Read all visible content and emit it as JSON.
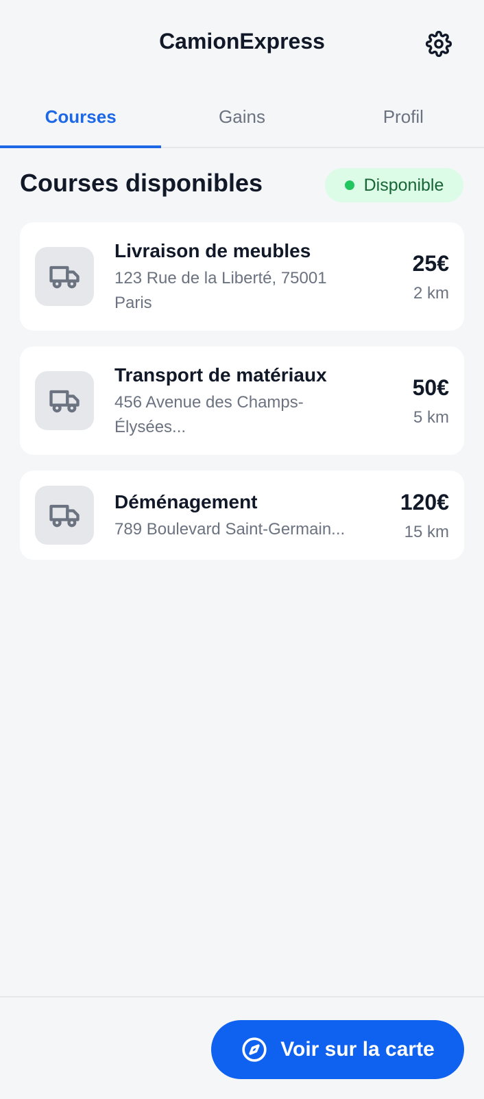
{
  "app": {
    "title": "CamionExpress",
    "settings_icon": "gear-icon"
  },
  "tabs": [
    {
      "label": "Courses",
      "active": true
    },
    {
      "label": "Gains",
      "active": false
    },
    {
      "label": "Profil",
      "active": false
    }
  ],
  "section": {
    "title": "Courses disponibles",
    "status": "Disponible",
    "status_color": "#22c55e"
  },
  "jobs": [
    {
      "icon": "truck-icon",
      "title": "Livraison de meubles",
      "address": "123 Rue de la Liberté, 75001 Paris",
      "price": "25€",
      "distance": "2 km"
    },
    {
      "icon": "truck-icon",
      "title": "Transport de matériaux",
      "address": "456 Avenue des Champs-Élysées...",
      "price": "50€",
      "distance": "5 km"
    },
    {
      "icon": "truck-icon",
      "title": "Déménagement",
      "address": "789 Boulevard Saint-Germain...",
      "price": "120€",
      "distance": "15 km"
    }
  ],
  "footer": {
    "map_button_label": "Voir sur la carte",
    "map_button_icon": "compass-icon",
    "accent": "#0f62f0"
  }
}
